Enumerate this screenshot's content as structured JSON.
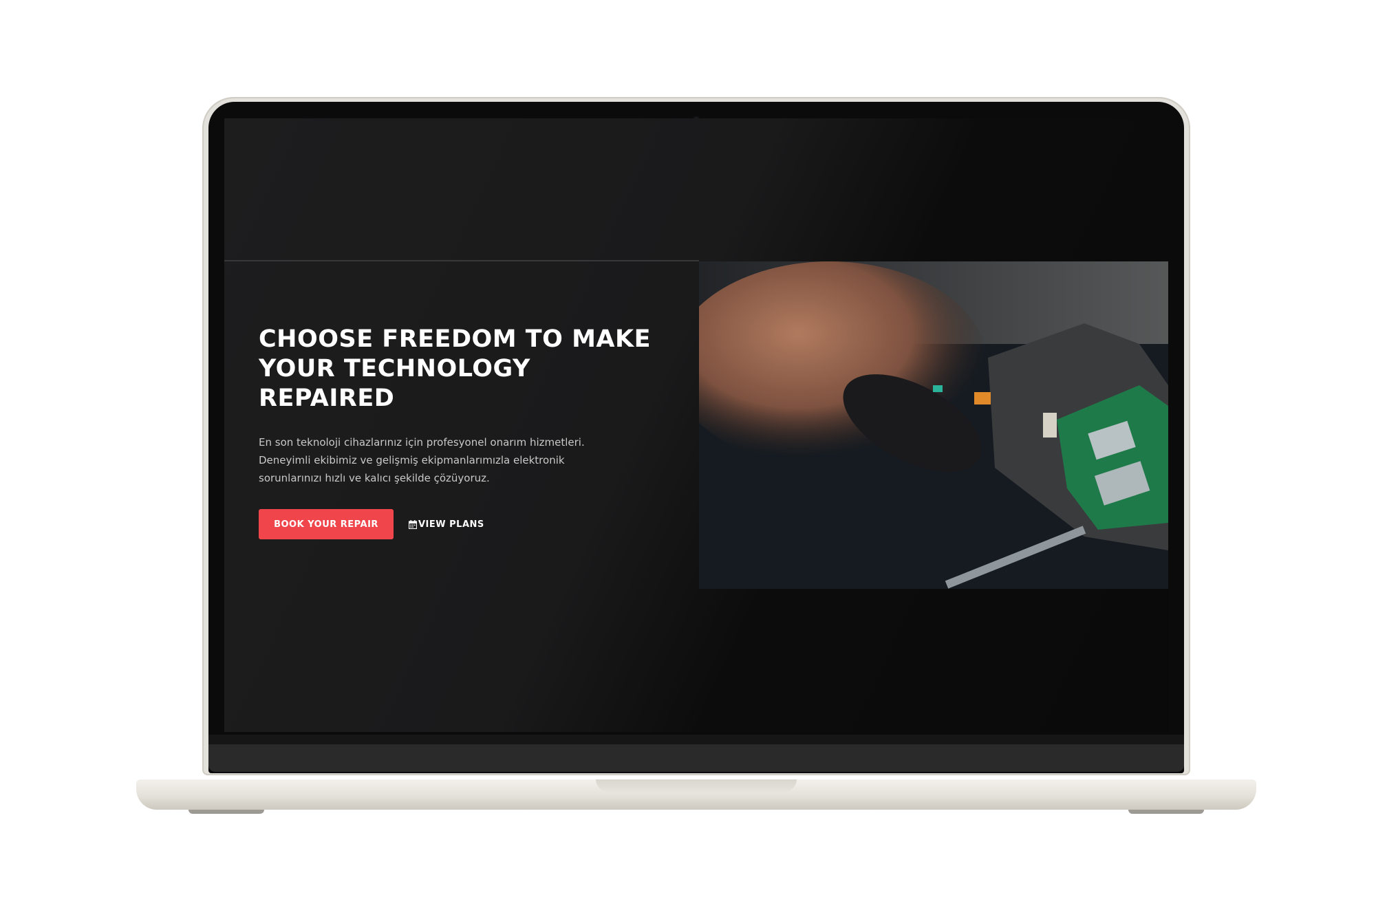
{
  "hero": {
    "title": "CHOOSE FREEDOM TO MAKE YOUR TECHNOLOGY REPAIRED",
    "description": "En son teknoloji cihazlarınız için profesyonel onarım hizmetleri. Deneyimli ekibimiz ve gelişmiş ekipmanlarımızla elektronik sorunlarınızı hızlı ve kalıcı şekilde çözüyoruz.",
    "primary_button_label": "BOOK YOUR REPAIR",
    "secondary_button_label": "VIEW PLANS",
    "secondary_button_icon": "calendar-icon",
    "image_subject": "hands repairing circuit board"
  },
  "colors": {
    "accent": "#f0464b",
    "background": "#1a1a1b",
    "text": "#ffffff",
    "muted_text": "#c9c9c9"
  }
}
